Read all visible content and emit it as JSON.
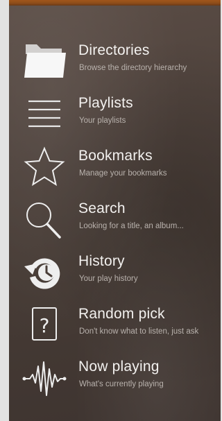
{
  "menu": {
    "items": [
      {
        "title": "Directories",
        "subtitle": "Browse the directory hierarchy",
        "icon": "folder-icon"
      },
      {
        "title": "Playlists",
        "subtitle": "Your playlists",
        "icon": "playlist-icon"
      },
      {
        "title": "Bookmarks",
        "subtitle": "Manage your bookmarks",
        "icon": "star-icon"
      },
      {
        "title": "Search",
        "subtitle": "Looking for a title, an album...",
        "icon": "search-icon"
      },
      {
        "title": "History",
        "subtitle": "Your play history",
        "icon": "history-icon"
      },
      {
        "title": "Random pick",
        "subtitle": "Don't know what to listen, just ask",
        "icon": "question-icon"
      },
      {
        "title": "Now playing",
        "subtitle": "What's currently playing",
        "icon": "waveform-icon"
      }
    ]
  },
  "colors": {
    "top_bar": "#8c4c1a",
    "panel": "#4a3e38",
    "title_text": "#f3f1ef",
    "subtitle_text": "#b9b2ad",
    "icon": "#eeeeee"
  }
}
